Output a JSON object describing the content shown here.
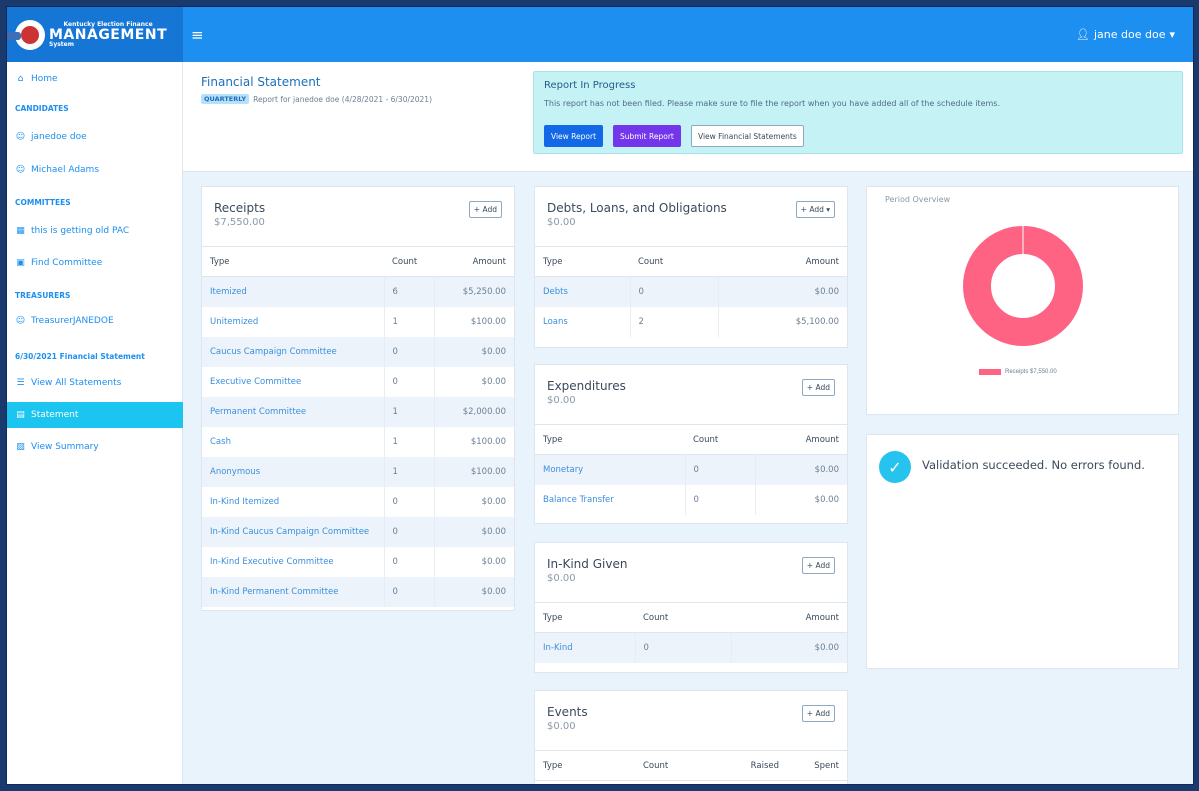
{
  "brand": {
    "line1": "Kentucky Election Finance",
    "line2": "MANAGEMENT",
    "line3": "System"
  },
  "header": {
    "menu_icon": "hamburger-icon",
    "user_name": "jane doe doe",
    "user_icon": "user-icon",
    "caret": "▾"
  },
  "sidebar": {
    "home": "Home",
    "candidates_heading": "CANDIDATES",
    "candidates": [
      "janedoe doe",
      "Michael Adams"
    ],
    "committees_heading": "COMMITTEES",
    "committee": "this is getting old PAC",
    "find_committee": "Find Committee",
    "treasurers_heading": "TREASURERS",
    "treasurer": "TreasurerJANEDOE",
    "statement_heading": "6/30/2021 Financial Statement",
    "view_all": "View All Statements",
    "statement": "Statement",
    "view_summary": "View Summary"
  },
  "page": {
    "title": "Financial Statement",
    "tag": "QUARTERLY",
    "subtitle": "Report for janedoe doe (4/28/2021 - 6/30/2021)"
  },
  "alert": {
    "title": "Report In Progress",
    "message": "This report has not been filed. Please make sure to file the report when you have added all of the schedule items.",
    "view_report": "View Report",
    "submit_report": "Submit Report",
    "view_statements": "View Financial Statements"
  },
  "add_label": "+ Add",
  "add_dropdown_label": "+ Add ▾",
  "receipts": {
    "title": "Receipts",
    "amount": "$7,550.00",
    "headers": [
      "Type",
      "Count",
      "Amount"
    ],
    "rows": [
      [
        "Itemized",
        "6",
        "$5,250.00"
      ],
      [
        "Unitemized",
        "1",
        "$100.00"
      ],
      [
        "Caucus Campaign Committee",
        "0",
        "$0.00"
      ],
      [
        "Executive Committee",
        "0",
        "$0.00"
      ],
      [
        "Permanent Committee",
        "1",
        "$2,000.00"
      ],
      [
        "Cash",
        "1",
        "$100.00"
      ],
      [
        "Anonymous",
        "1",
        "$100.00"
      ],
      [
        "In-Kind Itemized",
        "0",
        "$0.00"
      ],
      [
        "In-Kind Caucus Campaign Committee",
        "0",
        "$0.00"
      ],
      [
        "In-Kind Executive Committee",
        "0",
        "$0.00"
      ],
      [
        "In-Kind Permanent Committee",
        "0",
        "$0.00"
      ]
    ]
  },
  "debts": {
    "title": "Debts, Loans, and Obligations",
    "amount": "$0.00",
    "headers": [
      "Type",
      "Count",
      "Amount"
    ],
    "rows": [
      [
        "Debts",
        "0",
        "$0.00"
      ],
      [
        "Loans",
        "2",
        "$5,100.00"
      ]
    ]
  },
  "expenditures": {
    "title": "Expenditures",
    "amount": "$0.00",
    "headers": [
      "Type",
      "Count",
      "Amount"
    ],
    "rows": [
      [
        "Monetary",
        "0",
        "$0.00"
      ],
      [
        "Balance Transfer",
        "0",
        "$0.00"
      ]
    ]
  },
  "inkind": {
    "title": "In-Kind Given",
    "amount": "$0.00",
    "headers": [
      "Type",
      "Count",
      "Amount"
    ],
    "rows": [
      [
        "In-Kind",
        "0",
        "$0.00"
      ]
    ]
  },
  "events": {
    "title": "Events",
    "amount": "$0.00",
    "headers": [
      "Type",
      "Count",
      "Raised",
      "Spent"
    ]
  },
  "overview": {
    "title": "Period Overview",
    "legend": "Receipts $7,550.00",
    "color": "#ff6384"
  },
  "chart_data": {
    "type": "pie",
    "title": "",
    "categories": [
      "Receipts"
    ],
    "values": [
      7550
    ]
  },
  "validation": {
    "message": "Validation succeeded. No errors found.",
    "icon": "check-icon"
  }
}
